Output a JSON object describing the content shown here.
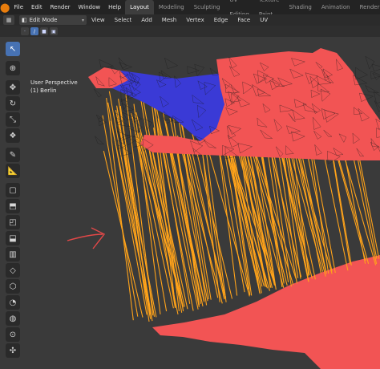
{
  "topbar": {
    "menus": [
      "File",
      "Edit",
      "Render",
      "Window",
      "Help"
    ],
    "workspaces": [
      "Layout",
      "Modeling",
      "Sculpting",
      "UV Editing",
      "Texture Paint",
      "Shading",
      "Animation",
      "Rendering"
    ],
    "active_workspace": "Layout"
  },
  "header": {
    "mode": "Edit Mode",
    "menus": [
      "View",
      "Select",
      "Add",
      "Mesh",
      "Vertex",
      "Edge",
      "Face",
      "UV"
    ]
  },
  "viewport": {
    "perspective": "User Perspective",
    "object": "(1) Berlin",
    "colors": {
      "mesh_red": "#f25454",
      "mesh_blue": "#3a3ad6",
      "extrude_orange": "#ffa31a",
      "background": "#3a3a3a"
    }
  },
  "toolbar": {
    "tools": [
      "select-box",
      "cursor",
      "move",
      "rotate",
      "scale",
      "transform",
      "annotate",
      "measure",
      "add-cube",
      "extrude",
      "inset",
      "bevel",
      "loop-cut",
      "knife",
      "poly-build",
      "spin",
      "smooth",
      "shrink-fatten",
      "shear",
      "rip"
    ],
    "active_tool": "select-box"
  }
}
